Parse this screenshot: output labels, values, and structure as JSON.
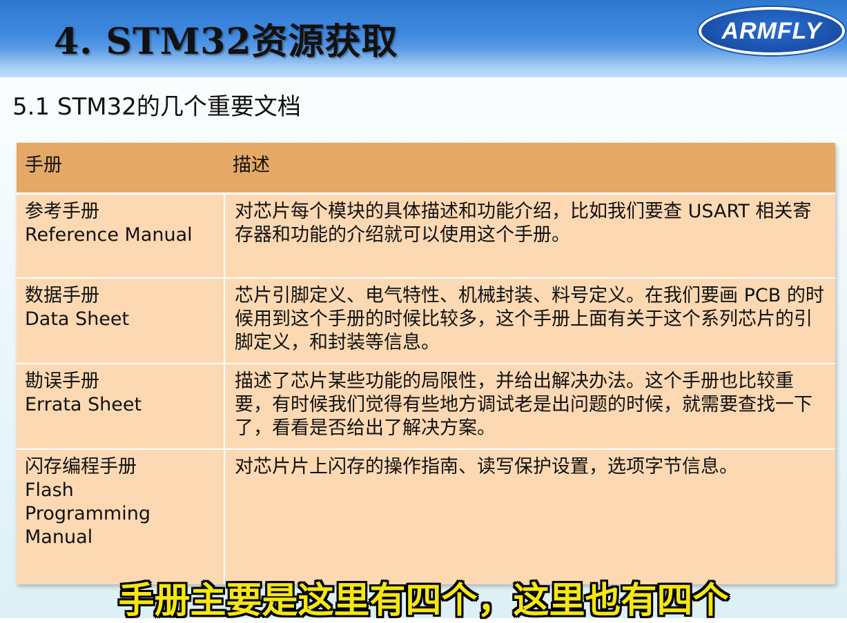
{
  "slide": {
    "title": "4. STM32资源获取",
    "logo_text": "ARMFLY",
    "subtitle": "5.1 STM32的几个重要文档"
  },
  "table": {
    "headers": [
      "手册",
      "描述"
    ],
    "rows": [
      {
        "name_lines": [
          "参考手册",
          "Reference Manual"
        ],
        "description": "对芯片每个模块的具体描述和功能介绍，比如我们要查 USART 相关寄存器和功能的介绍就可以使用这个手册。"
      },
      {
        "name_lines": [
          "数据手册",
          "Data Sheet"
        ],
        "description": "芯片引脚定义、电气特性、机械封装、料号定义。在我们要画 PCB 的时候用到这个手册的时候比较多，这个手册上面有关于这个系列芯片的引脚定义，和封装等信息。"
      },
      {
        "name_lines": [
          "勘误手册",
          "Errata Sheet"
        ],
        "description": "描述了芯片某些功能的局限性，并给出解决办法。这个手册也比较重要，有时候我们觉得有些地方调试老是出问题的时候，就需要查找一下了，看看是否给出了解决方案。"
      },
      {
        "name_lines": [
          "闪存编程手册",
          "Flash",
          "Programming",
          "Manual"
        ],
        "description": "对芯片片上闪存的操作指南、读写保护设置，选项字节信息。"
      }
    ]
  },
  "video_caption": "手册主要是这里有四个，这里也有四个",
  "colors": {
    "header_blue": "#3f8ae0",
    "table_header": "#e4a867",
    "table_cell": "#fcd9b3",
    "caption_yellow": "#f5e612"
  }
}
